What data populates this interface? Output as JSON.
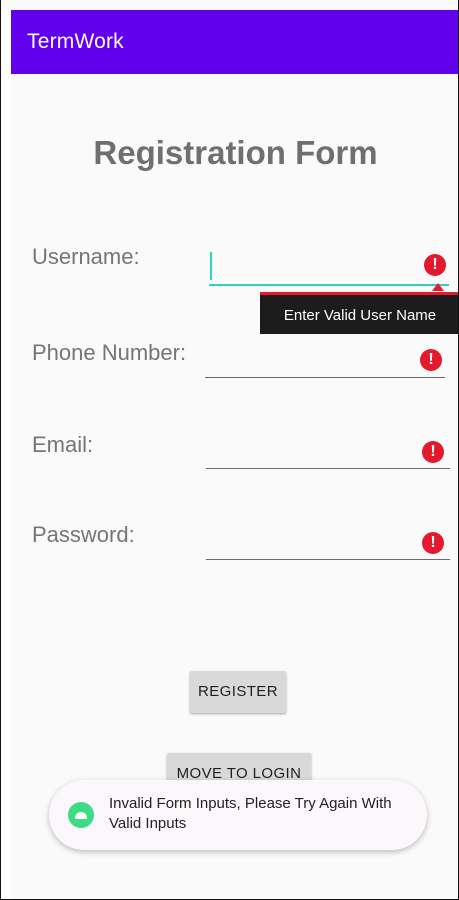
{
  "appbar": {
    "title": "TermWork",
    "color": "#6200ee"
  },
  "form": {
    "title": "Registration Form",
    "fields": [
      {
        "label": "Username:",
        "value": "",
        "focused": true,
        "error_icon": "error-circle-icon"
      },
      {
        "label": "Phone Number:",
        "value": "",
        "focused": false,
        "error_icon": "error-circle-icon"
      },
      {
        "label": "Email:",
        "value": "",
        "focused": false,
        "error_icon": "error-circle-icon"
      },
      {
        "label": "Password:",
        "value": "",
        "focused": false,
        "error_icon": "error-circle-icon"
      }
    ],
    "error_tooltip": "Enter Valid User Name",
    "error_color": "#e5192d",
    "focus_color": "#2ed3c0"
  },
  "buttons": {
    "register_label": "REGISTER",
    "move_to_login_label": "MOVE TO LOGIN"
  },
  "toast": {
    "icon": "android-icon",
    "message": "Invalid Form Inputs, Please Try Again With Valid Inputs"
  }
}
